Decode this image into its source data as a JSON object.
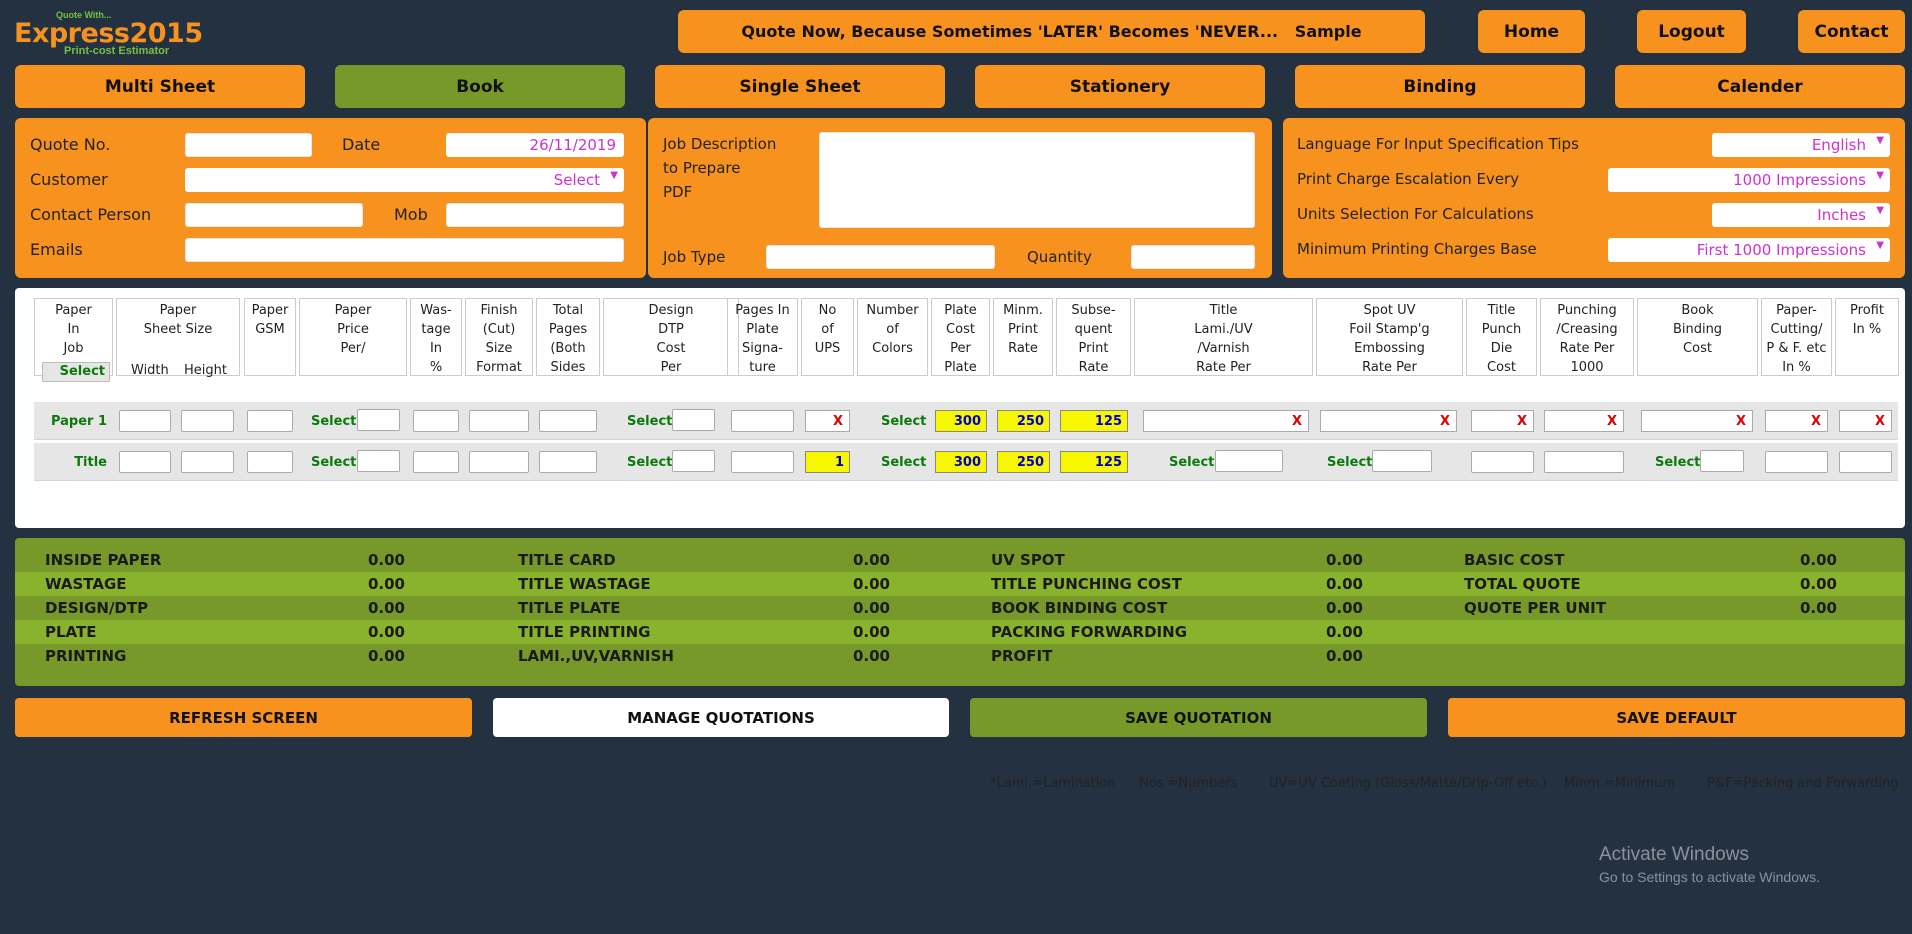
{
  "logo": {
    "line1": "Quote With...",
    "line2": "Express2015",
    "line3": "Print-cost Estimator"
  },
  "header": {
    "banner": "Quote Now, Because Sometimes 'LATER' Becomes 'NEVER...   Sample",
    "home": "Home",
    "logout": "Logout",
    "contact": "Contact"
  },
  "tabs": [
    "Multi Sheet",
    "Book",
    "Single Sheet",
    "Stationery",
    "Binding",
    "Calender"
  ],
  "form": {
    "quote_no": "Quote No.",
    "date": "Date",
    "date_value": "26/11/2019",
    "customer": "Customer",
    "customer_select": "Select",
    "contact_person": "Contact Person",
    "mob": "Mob",
    "emails": "Emails",
    "job_desc_1": "Job Description",
    "job_desc_2": "to Prepare",
    "job_desc_3": "PDF",
    "job_type": "Job Type",
    "quantity": "Quantity",
    "lang_label": "Language For Input Specification Tips",
    "lang_value": "English",
    "esc_label": "Print Charge Escalation Every",
    "esc_value": "1000 Impressions",
    "units_label": "Units Selection For Calculations",
    "units_value": "Inches",
    "min_label": "Minimum Printing Charges Base",
    "min_value": "First 1000 Impressions"
  },
  "table": {
    "headers": [
      "Paper\nIn\nJob",
      "Paper\nSheet Size",
      "Paper\nGSM",
      "Paper\nPrice\nPer/",
      "Was-\ntage\nIn\n%",
      "Finish\n(Cut)\nSize\nFormat",
      "Total\nPages\n(Both\nSides",
      "Design\nDTP\nCost\nPer",
      "Pages In\nPlate\nSigna-\nture",
      "No\nof\nUPS",
      "Number\nof\nColors",
      "Plate\nCost\nPer\nPlate",
      "Minm.\nPrint\nRate",
      "Subse-\nquent\nPrint\nRate",
      "Title\nLami./UV\n/Varnish\nRate Per",
      "Spot UV\nFoil Stamp'g\nEmbossing\nRate Per",
      "Title\nPunch\nDie\nCost",
      "Punching\n/Creasing\nRate Per\n1000",
      "Book\nBinding\nCost",
      "Paper-\nCutting/\nP & F. etc\nIn %",
      "Profit\nIn %"
    ],
    "header_select": "Select",
    "width": "Width",
    "height": "Height",
    "select": "Select",
    "x": "X",
    "row1": {
      "label": "Paper 1",
      "ups": "X",
      "plate": "300",
      "minm": "250",
      "subs": "125"
    },
    "row2": {
      "label": "Title",
      "ups": "1",
      "plate": "300",
      "minm": "250",
      "subs": "125"
    },
    "footnotes": [
      "*Lami.=Lamination",
      "Nos.=Numbers",
      "UV=UV Coating (Gloss/Matte/Drip-Off etc.)",
      "Minm.=Minimum",
      "P&F=Packing and Forwarding"
    ]
  },
  "summary": {
    "col1": [
      [
        "INSIDE PAPER",
        "0.00"
      ],
      [
        "WASTAGE",
        "0.00"
      ],
      [
        "DESIGN/DTP",
        "0.00"
      ],
      [
        "PLATE",
        "0.00"
      ],
      [
        "PRINTING",
        "0.00"
      ]
    ],
    "col2": [
      [
        "TITLE CARD",
        "0.00"
      ],
      [
        "TITLE WASTAGE",
        "0.00"
      ],
      [
        "TITLE PLATE",
        "0.00"
      ],
      [
        "TITLE PRINTING",
        "0.00"
      ],
      [
        "LAMI.,UV,VARNISH",
        "0.00"
      ]
    ],
    "col3": [
      [
        "UV SPOT",
        "0.00"
      ],
      [
        "TITLE PUNCHING COST",
        "0.00"
      ],
      [
        "BOOK BINDING COST",
        "0.00"
      ],
      [
        "PACKING FORWARDING",
        "0.00"
      ],
      [
        "PROFIT",
        "0.00"
      ]
    ],
    "col4": [
      [
        "BASIC COST",
        "0.00"
      ],
      [
        "TOTAL QUOTE",
        "0.00"
      ],
      [
        "QUOTE PER UNIT",
        "0.00"
      ]
    ]
  },
  "actions": {
    "refresh": "REFRESH SCREEN",
    "manage": "MANAGE QUOTATIONS",
    "save": "SAVE QUOTATION",
    "default": "SAVE DEFAULT"
  },
  "watermark": {
    "line1": "Activate Windows",
    "line2": "Go to Settings to activate Windows."
  }
}
